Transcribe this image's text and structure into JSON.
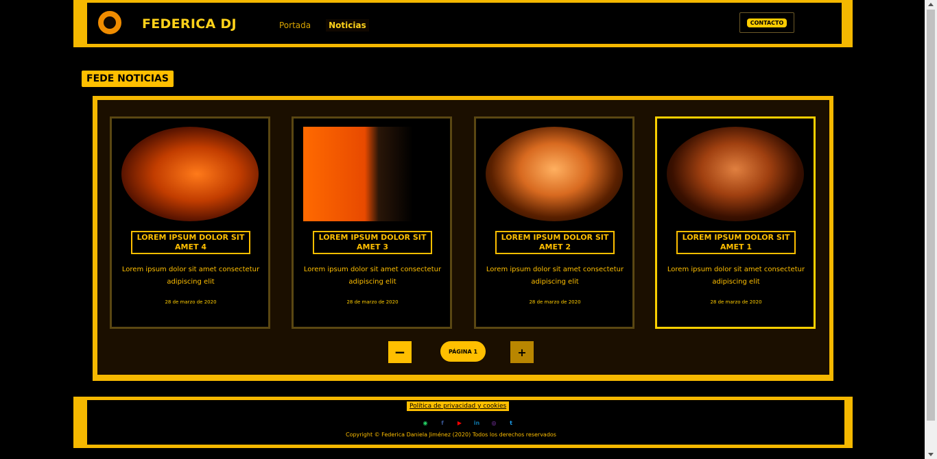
{
  "header": {
    "brand": "FEDERICA DJ",
    "nav": [
      "Portada",
      "Noticias"
    ],
    "active_nav": "Noticias",
    "contact_label": "CONTACTO"
  },
  "section": {
    "title": "FEDE NOTICIAS"
  },
  "cards": [
    {
      "title": "LOREM IPSUM DOLOR SIT AMET 4",
      "desc": "Lorem ipsum dolor sit amet consectetur adipiscing elit",
      "date": "28 de marzo de 2020"
    },
    {
      "title": "LOREM IPSUM DOLOR SIT AMET 3",
      "desc": "Lorem ipsum dolor sit amet consectetur adipiscing elit",
      "date": "28 de marzo de 2020"
    },
    {
      "title": "LOREM IPSUM DOLOR SIT AMET 2",
      "desc": "Lorem ipsum dolor sit amet consectetur adipiscing elit",
      "date": "28 de marzo de 2020"
    },
    {
      "title": "LOREM IPSUM DOLOR SIT AMET 1",
      "desc": "Lorem ipsum dolor sit amet consectetur adipiscing elit",
      "date": "28 de marzo de 2020"
    }
  ],
  "pager": {
    "minus": "−",
    "plus": "+",
    "page_label": "PÁGINA 1"
  },
  "footer": {
    "policy": "Política de privacidad y cookies",
    "copyright": "Copyright © Federica Daniela Jiménez (2020) Todos los derechos reservados",
    "socials": [
      {
        "icon": "whatsapp-icon",
        "glyph": "◉",
        "color": "#25d366"
      },
      {
        "icon": "facebook-icon",
        "glyph": "f",
        "color": "#3b5998"
      },
      {
        "icon": "youtube-icon",
        "glyph": "▶",
        "color": "#ff0000"
      },
      {
        "icon": "linkedin-icon",
        "glyph": "in",
        "color": "#0e76a8"
      },
      {
        "icon": "instagram-icon",
        "glyph": "◎",
        "color": "#8a3ab9"
      },
      {
        "icon": "twitter-icon",
        "glyph": "t",
        "color": "#1da1f2"
      }
    ]
  },
  "colors": {
    "accent": "#f5b800",
    "background": "#000000",
    "panel": "#1b0f00"
  }
}
